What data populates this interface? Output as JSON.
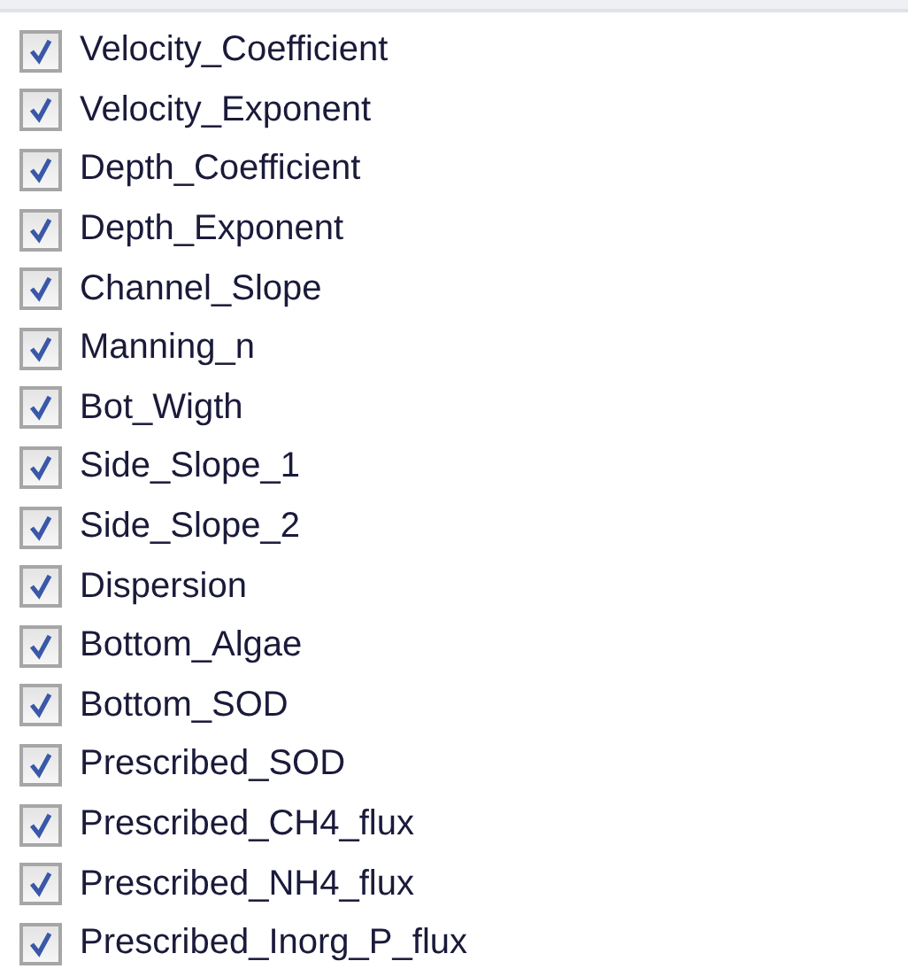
{
  "items": [
    {
      "label": "Velocity_Coefficient",
      "checked": true
    },
    {
      "label": "Velocity_Exponent",
      "checked": true
    },
    {
      "label": "Depth_Coefficient",
      "checked": true
    },
    {
      "label": "Depth_Exponent",
      "checked": true
    },
    {
      "label": "Channel_Slope",
      "checked": true
    },
    {
      "label": "Manning_n",
      "checked": true
    },
    {
      "label": "Bot_Wigth",
      "checked": true
    },
    {
      "label": "Side_Slope_1",
      "checked": true
    },
    {
      "label": "Side_Slope_2",
      "checked": true
    },
    {
      "label": "Dispersion",
      "checked": true
    },
    {
      "label": "Bottom_Algae",
      "checked": true
    },
    {
      "label": "Bottom_SOD",
      "checked": true
    },
    {
      "label": "Prescribed_SOD",
      "checked": true
    },
    {
      "label": "Prescribed_CH4_flux",
      "checked": true
    },
    {
      "label": "Prescribed_NH4_flux",
      "checked": true
    },
    {
      "label": "Prescribed_Inorg_P_flux",
      "checked": true
    }
  ]
}
